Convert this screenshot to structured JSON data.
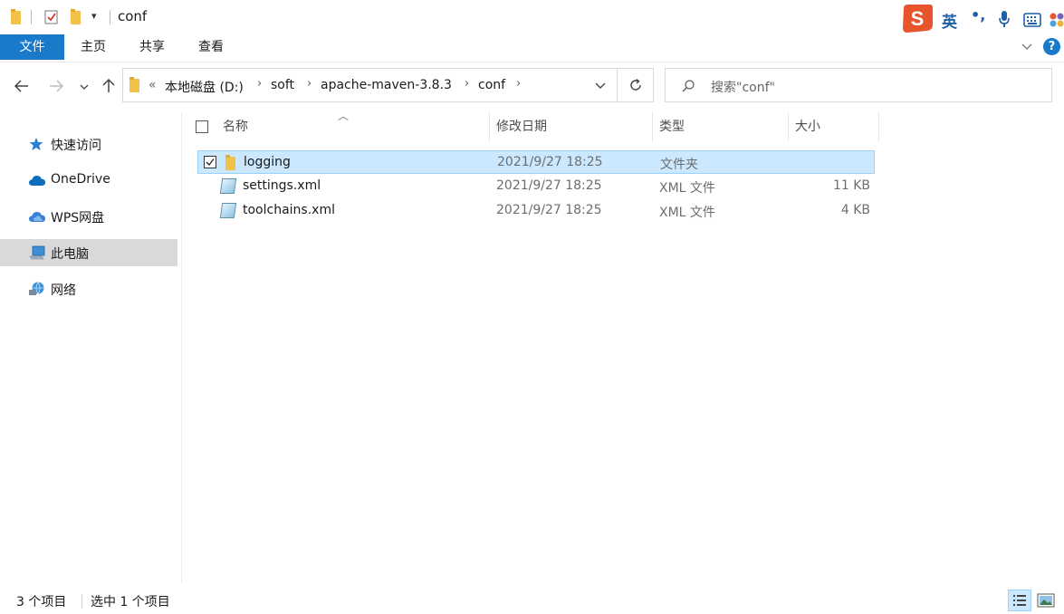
{
  "window": {
    "title": "conf"
  },
  "ribbon": {
    "tabs": [
      {
        "label": "文件"
      },
      {
        "label": "主页"
      },
      {
        "label": "共享"
      },
      {
        "label": "查看"
      }
    ]
  },
  "ime": {
    "mode": "英",
    "punct": "•,"
  },
  "address": {
    "overflow": "«",
    "crumbs": [
      "本地磁盘 (D:)",
      "soft",
      "apache-maven-3.8.3",
      "conf"
    ]
  },
  "search": {
    "placeholder": "搜索\"conf\""
  },
  "sidebar": {
    "items": [
      {
        "label": "快速访问"
      },
      {
        "label": "OneDrive"
      },
      {
        "label": "WPS网盘"
      },
      {
        "label": "此电脑"
      },
      {
        "label": "网络"
      }
    ]
  },
  "columns": {
    "name": "名称",
    "date": "修改日期",
    "type": "类型",
    "size": "大小"
  },
  "files": [
    {
      "name": "logging",
      "date": "2021/9/27 18:25",
      "type": "文件夹",
      "size": ""
    },
    {
      "name": "settings.xml",
      "date": "2021/9/27 18:25",
      "type": "XML 文件",
      "size": "11 KB"
    },
    {
      "name": "toolchains.xml",
      "date": "2021/9/27 18:25",
      "type": "XML 文件",
      "size": "4 KB"
    }
  ],
  "status": {
    "count": "3 个项目",
    "selected": "选中 1 个项目"
  },
  "colors": {
    "accent": "#1979ca",
    "selection": "#cce8ff"
  }
}
